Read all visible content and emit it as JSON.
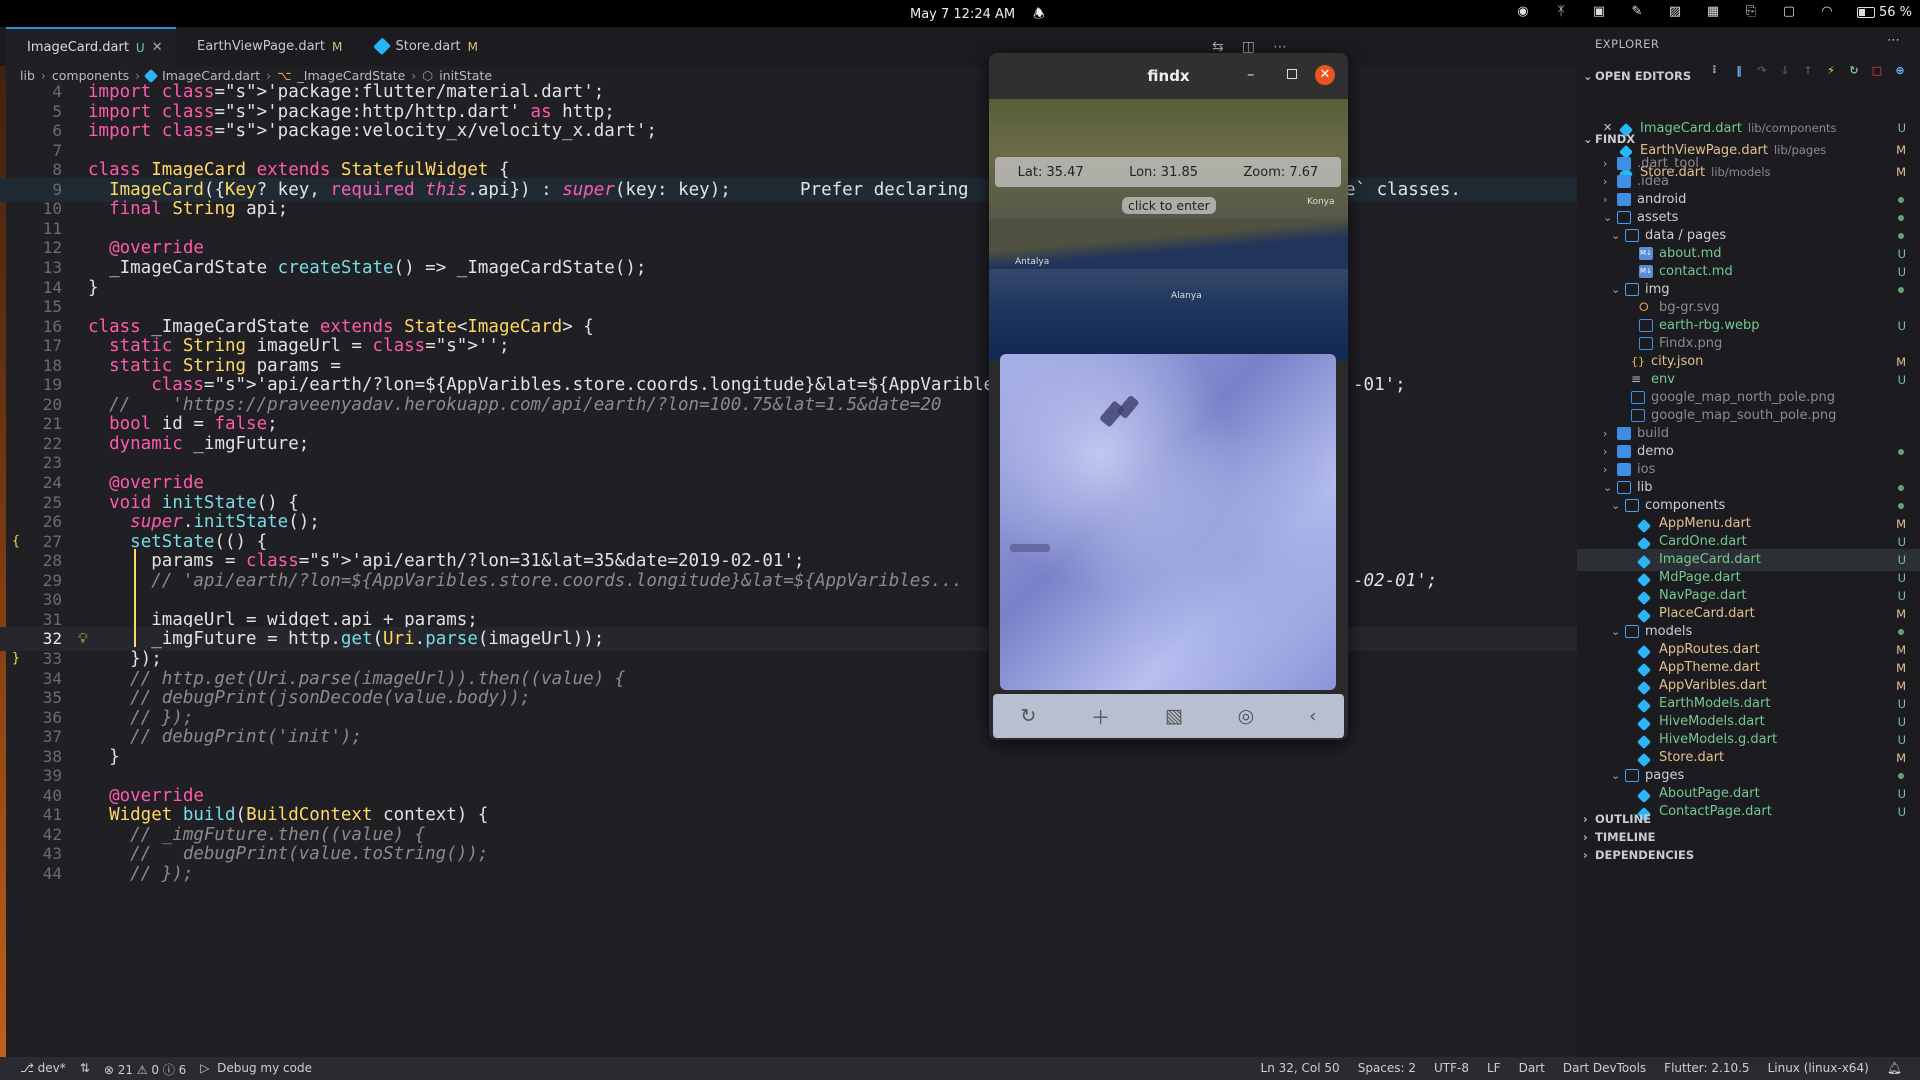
{
  "topbar": {
    "datetime": "May 7  12:24 AM",
    "battery": "56 %"
  },
  "tabs": [
    {
      "name": "ImageCard.dart",
      "status": "U",
      "active": true
    },
    {
      "name": "EarthViewPage.dart",
      "status": "M",
      "active": false
    },
    {
      "name": "Store.dart",
      "status": "M",
      "active": false
    }
  ],
  "breadcrumb": [
    "lib",
    "components",
    "ImageCard.dart",
    "_ImageCardState",
    "initState"
  ],
  "code": {
    "lines": [
      {
        "n": "4",
        "text": "import 'package:flutter/material.dart';"
      },
      {
        "n": "5",
        "text": "import 'package:http/http.dart' as http;"
      },
      {
        "n": "6",
        "text": "import 'package:velocity_x/velocity_x.dart';"
      },
      {
        "n": "7",
        "text": ""
      },
      {
        "n": "8",
        "text": "class ImageCard extends StatefulWidget {"
      },
      {
        "n": "9",
        "text": "  ImageCard({Key? key, required this.api}) : super(key: key);"
      },
      {
        "n": "10",
        "text": "  final String api;"
      },
      {
        "n": "11",
        "text": ""
      },
      {
        "n": "12",
        "text": "  @override"
      },
      {
        "n": "13",
        "text": "  _ImageCardState createState() => _ImageCardState();"
      },
      {
        "n": "14",
        "text": "}"
      },
      {
        "n": "15",
        "text": ""
      },
      {
        "n": "16",
        "text": "class _ImageCardState extends State<ImageCard> {"
      },
      {
        "n": "17",
        "text": "  static String imageUrl = '';"
      },
      {
        "n": "18",
        "text": "  static String params ="
      },
      {
        "n": "19",
        "text": "      'api/earth/?lon=${AppVaribles.store.coords.longitude}&lat=${AppVaribles.stor"
      },
      {
        "n": "20",
        "text": "  //    'https://praveenyadav.herokuapp.com/api/earth/?lon=100.75&lat=1.5&date=20"
      },
      {
        "n": "21",
        "text": "  bool id = false;"
      },
      {
        "n": "22",
        "text": "  dynamic _imgFuture;"
      },
      {
        "n": "23",
        "text": ""
      },
      {
        "n": "24",
        "text": "  @override"
      },
      {
        "n": "25",
        "text": "  void initState() {"
      },
      {
        "n": "26",
        "text": "    super.initState();"
      },
      {
        "n": "27",
        "text": "    setState(() {"
      },
      {
        "n": "28",
        "text": "      params = 'api/earth/?lon=31&lat=35&date=2019-02-01';"
      },
      {
        "n": "29",
        "text": "      // 'api/earth/?lon=${AppVaribles.store.coords.longitude}&lat=${AppVaribles..."
      },
      {
        "n": "30",
        "text": ""
      },
      {
        "n": "31",
        "text": "      imageUrl = widget.api + params;"
      },
      {
        "n": "32",
        "text": "      _imgFuture = http.get(Uri.parse(imageUrl));"
      },
      {
        "n": "33",
        "text": "    });"
      },
      {
        "n": "34",
        "text": "    // http.get(Uri.parse(imageUrl)).then((value) {"
      },
      {
        "n": "35",
        "text": "    // debugPrint(jsonDecode(value.body));"
      },
      {
        "n": "36",
        "text": "    // });"
      },
      {
        "n": "37",
        "text": "    // debugPrint('init');"
      },
      {
        "n": "38",
        "text": "  }"
      },
      {
        "n": "39",
        "text": ""
      },
      {
        "n": "40",
        "text": "  @override"
      },
      {
        "n": "41",
        "text": "  Widget build(BuildContext context) {"
      },
      {
        "n": "42",
        "text": "    // _imgFuture.then((value) {"
      },
      {
        "n": "43",
        "text": "    //   debugPrint(value.toString());"
      },
      {
        "n": "44",
        "text": "    // });"
      }
    ],
    "hint9": "Prefer declaring",
    "hint9b": "e` classes.",
    "tail19": "-01';",
    "tail29": "-02-01';"
  },
  "explorer": {
    "title": "EXPLORER",
    "open_editors_label": "OPEN EDITORS",
    "open_editors": [
      {
        "name": "ImageCard.dart",
        "path": "lib/components",
        "status": "U"
      },
      {
        "name": "EarthViewPage.dart",
        "path": "lib/pages",
        "status": "M"
      },
      {
        "name": "Store.dart",
        "path": "lib/models",
        "status": "M"
      }
    ],
    "project_label": "FINDX",
    "tree": [
      {
        "name": ".dart_tool",
        "kind": "folder",
        "depth": 0,
        "open": false,
        "status": ""
      },
      {
        "name": ".idea",
        "kind": "folder",
        "depth": 0,
        "open": false,
        "status": ""
      },
      {
        "name": "android",
        "kind": "folder",
        "depth": 0,
        "open": false,
        "status": "dot"
      },
      {
        "name": "assets",
        "kind": "folder",
        "depth": 0,
        "open": true,
        "status": "dot"
      },
      {
        "name": "data / pages",
        "kind": "folder",
        "depth": 1,
        "open": true,
        "status": "dot"
      },
      {
        "name": "about.md",
        "kind": "md",
        "depth": 2,
        "status": "U"
      },
      {
        "name": "contact.md",
        "kind": "md",
        "depth": 2,
        "status": "U"
      },
      {
        "name": "img",
        "kind": "folder",
        "depth": 1,
        "open": true,
        "status": "dot"
      },
      {
        "name": "bg-gr.svg",
        "kind": "svg",
        "depth": 2,
        "status": ""
      },
      {
        "name": "earth-rbg.webp",
        "kind": "img",
        "depth": 2,
        "status": "U"
      },
      {
        "name": "Findx.png",
        "kind": "img",
        "depth": 2,
        "status": ""
      },
      {
        "name": "city.json",
        "kind": "json",
        "depth": 1,
        "status": "M"
      },
      {
        "name": "env",
        "kind": "file",
        "depth": 1,
        "status": "U"
      },
      {
        "name": "google_map_north_pole.png",
        "kind": "img",
        "depth": 1,
        "status": ""
      },
      {
        "name": "google_map_south_pole.png",
        "kind": "img",
        "depth": 1,
        "status": ""
      },
      {
        "name": "build",
        "kind": "folder",
        "depth": 0,
        "open": false,
        "status": ""
      },
      {
        "name": "demo",
        "kind": "folder",
        "depth": 0,
        "open": false,
        "status": "dot"
      },
      {
        "name": "ios",
        "kind": "folder",
        "depth": 0,
        "open": false,
        "status": ""
      },
      {
        "name": "lib",
        "kind": "folder",
        "depth": 0,
        "open": true,
        "status": "dot"
      },
      {
        "name": "components",
        "kind": "folder",
        "depth": 1,
        "open": true,
        "status": "dot"
      },
      {
        "name": "AppMenu.dart",
        "kind": "dart",
        "depth": 2,
        "status": "M"
      },
      {
        "name": "CardOne.dart",
        "kind": "dart",
        "depth": 2,
        "status": "U"
      },
      {
        "name": "ImageCard.dart",
        "kind": "dart",
        "depth": 2,
        "status": "U",
        "selected": true
      },
      {
        "name": "MdPage.dart",
        "kind": "dart",
        "depth": 2,
        "status": "U"
      },
      {
        "name": "NavPage.dart",
        "kind": "dart",
        "depth": 2,
        "status": "U"
      },
      {
        "name": "PlaceCard.dart",
        "kind": "dart",
        "depth": 2,
        "status": "M"
      },
      {
        "name": "models",
        "kind": "folder",
        "depth": 1,
        "open": true,
        "status": "dot"
      },
      {
        "name": "AppRoutes.dart",
        "kind": "dart",
        "depth": 2,
        "status": "M"
      },
      {
        "name": "AppTheme.dart",
        "kind": "dart",
        "depth": 2,
        "status": "M"
      },
      {
        "name": "AppVaribles.dart",
        "kind": "dart",
        "depth": 2,
        "status": "M"
      },
      {
        "name": "EarthModels.dart",
        "kind": "dart",
        "depth": 2,
        "status": "U"
      },
      {
        "name": "HiveModels.dart",
        "kind": "dart",
        "depth": 2,
        "status": "U"
      },
      {
        "name": "HiveModels.g.dart",
        "kind": "dart",
        "depth": 2,
        "status": "U"
      },
      {
        "name": "Store.dart",
        "kind": "dart",
        "depth": 2,
        "status": "M"
      },
      {
        "name": "pages",
        "kind": "folder",
        "depth": 1,
        "open": true,
        "status": "dot"
      },
      {
        "name": "AboutPage.dart",
        "kind": "dart",
        "depth": 2,
        "status": "U"
      },
      {
        "name": "ContactPage.dart",
        "kind": "dart",
        "depth": 2,
        "status": "U"
      }
    ],
    "sections": [
      "OUTLINE",
      "TIMELINE",
      "DEPENDENCIES"
    ]
  },
  "statusbar": {
    "branch": "dev*",
    "errors": "21",
    "warnings": "0",
    "infos": "6",
    "debug": "Debug my code",
    "position": "Ln 32, Col 50",
    "spaces": "Spaces: 2",
    "encoding": "UTF-8",
    "eol": "LF",
    "language": "Dart",
    "devtools": "Dart DevTools",
    "flutter": "Flutter: 2.10.5",
    "platform": "Linux (linux-x64)"
  },
  "app": {
    "title": "findx",
    "lat": "Lat: 35.47",
    "lon": "Lon: 31.85",
    "zoom": "Zoom: 7.67",
    "hint": "click to enter",
    "map_labels": [
      "Antalya",
      "Alanya",
      "Konya"
    ]
  },
  "colors": {
    "accent": "#2f8fdf",
    "modified": "#e2c08d",
    "untracked": "#73c991",
    "close_button": "#e95420"
  }
}
